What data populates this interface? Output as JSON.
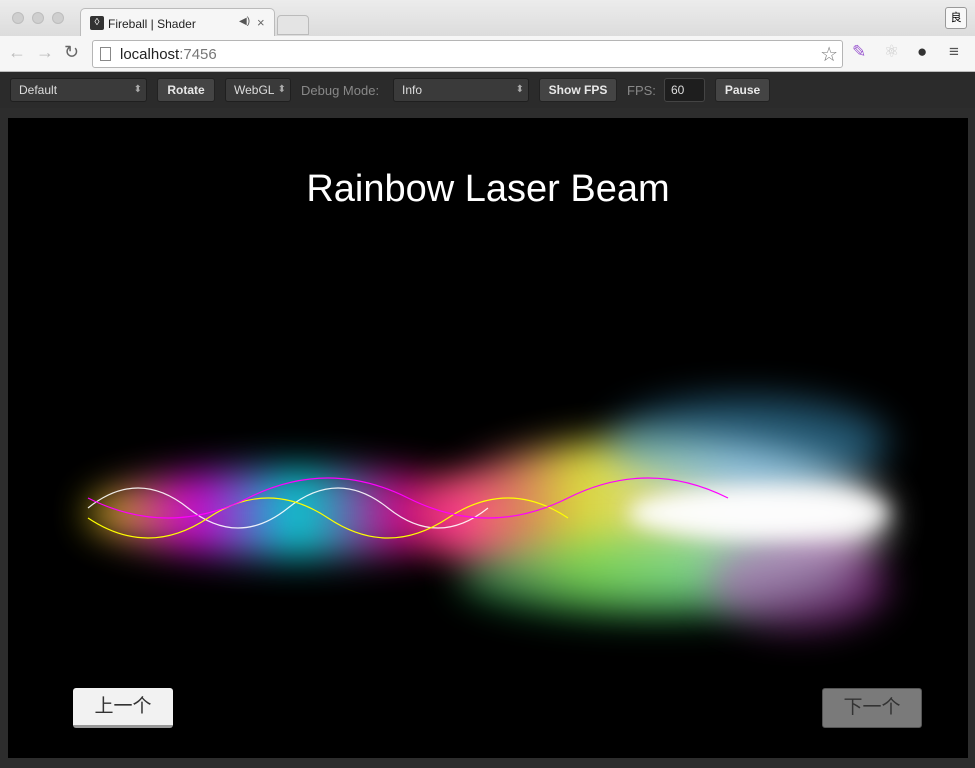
{
  "browser": {
    "tab_title": "Fireball | Shader",
    "url_host": "localhost",
    "url_port": ":7456",
    "ext_label": "良"
  },
  "toolbar": {
    "scene_select": "Default",
    "rotate": "Rotate",
    "renderer_select": "WebGL",
    "debug_label": "Debug Mode:",
    "debug_select": "Info",
    "show_fps": "Show FPS",
    "fps_label": "FPS:",
    "fps_value": "60",
    "pause": "Pause"
  },
  "stage": {
    "title": "Rainbow Laser Beam",
    "prev": "上一个",
    "next": "下一个"
  }
}
